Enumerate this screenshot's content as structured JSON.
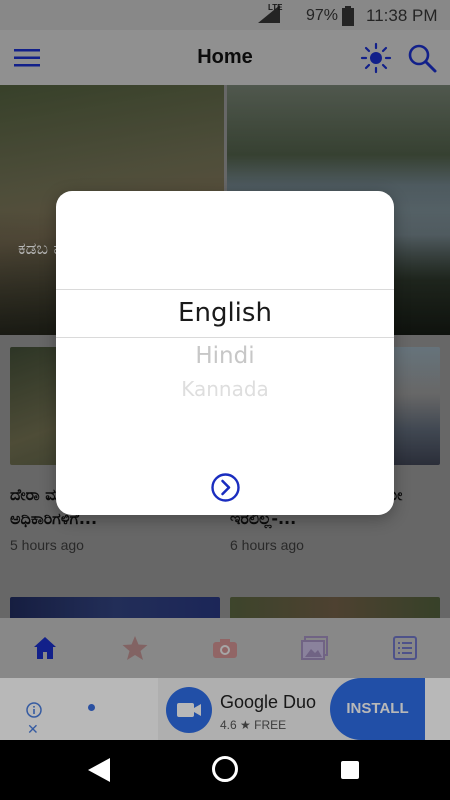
{
  "status_bar": {
    "network": "LTE",
    "battery": "97%",
    "time": "11:38 PM"
  },
  "app_bar": {
    "title": "Home"
  },
  "hero": {
    "title": "ಕಡಬ ಮರ ರಸ್ತೆ"
  },
  "cards": [
    {
      "title": "ದೇರಾ ಮುಚ್ಚಲು ಮೇಸಾ- ಮೇಷ: ಅಧಿಕಾರಿಗಳಿಗೆ...",
      "time": "5 hours ago"
    },
    {
      "title": "ಶಾಸಕರಾಗುವಾಗ ನಾನು ಹುಟ್ಟಿಯೇ ಇರಲಿಲ್ಲ-...",
      "time": "6 hours ago"
    }
  ],
  "bottom_nav": [
    "home-icon",
    "star-icon",
    "camera-icon",
    "gallery-icon",
    "list-icon"
  ],
  "ad": {
    "app_name": "Google Duo",
    "rating": "4.6 ★ FREE",
    "install_label": "INSTALL"
  },
  "language_picker": {
    "options": [
      "English",
      "Hindi",
      "Kannada"
    ],
    "selected": "English"
  },
  "colors": {
    "accent": "#1a2dbf",
    "ad_blue": "#2f6ee8"
  }
}
